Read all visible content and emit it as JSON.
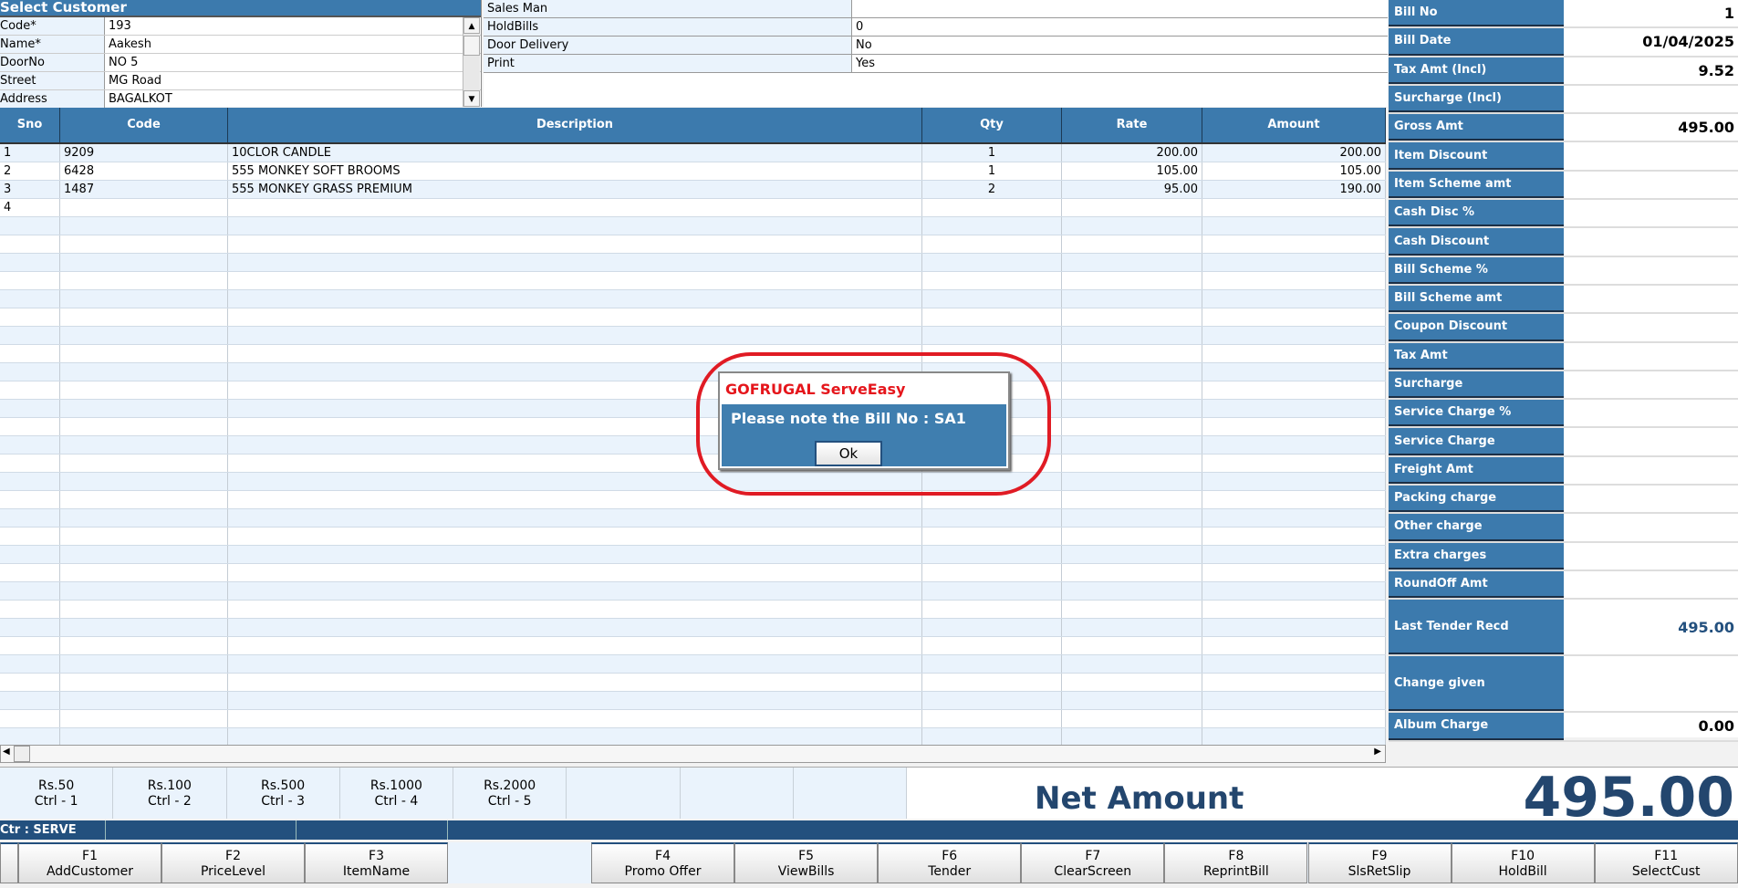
{
  "customer": {
    "title": "Select Customer",
    "fields": [
      {
        "label": "Code*",
        "value": "193"
      },
      {
        "label": "Name*",
        "value": "Aakesh"
      },
      {
        "label": "DoorNo",
        "value": "NO 5"
      },
      {
        "label": "Street",
        "value": "MG Road"
      },
      {
        "label": "Address",
        "value": "BAGALKOT"
      }
    ]
  },
  "info": [
    {
      "label": "Sales Man",
      "value": ""
    },
    {
      "label": "HoldBills",
      "value": "0"
    },
    {
      "label": "Door Delivery",
      "value": "No"
    },
    {
      "label": "Print",
      "value": "Yes"
    }
  ],
  "grid": {
    "headers": [
      "Sno",
      "Code",
      "Description",
      "Qty",
      "Rate",
      "Amount"
    ],
    "rows": [
      [
        "1",
        "9209",
        "10CLOR CANDLE",
        "1",
        "200.00",
        "200.00"
      ],
      [
        "2",
        "6428",
        "555 MONKEY SOFT BROOMS",
        "1",
        "105.00",
        "105.00"
      ],
      [
        "3",
        "1487",
        "555 MONKEY GRASS PREMIUM",
        "2",
        "95.00",
        "190.00"
      ],
      [
        "4",
        "",
        "",
        "",
        "",
        ""
      ]
    ]
  },
  "summary": [
    {
      "label": "Bill No",
      "value": "1"
    },
    {
      "label": "Bill Date",
      "value": "01/04/2025"
    },
    {
      "label": "Tax Amt (Incl)",
      "value": "9.52"
    },
    {
      "label": "Surcharge (Incl)",
      "value": ""
    },
    {
      "label": "Gross Amt",
      "value": "495.00"
    },
    {
      "label": "Item Discount",
      "value": ""
    },
    {
      "label": "Item Scheme amt",
      "value": ""
    },
    {
      "label": "Cash Disc %",
      "value": ""
    },
    {
      "label": "Cash Discount",
      "value": ""
    },
    {
      "label": "Bill Scheme %",
      "value": ""
    },
    {
      "label": "Bill Scheme amt",
      "value": ""
    },
    {
      "label": "Coupon Discount",
      "value": ""
    },
    {
      "label": "Tax Amt",
      "value": ""
    },
    {
      "label": "Surcharge",
      "value": ""
    },
    {
      "label": "Service Charge %",
      "value": ""
    },
    {
      "label": "Service Charge",
      "value": ""
    },
    {
      "label": "Freight Amt",
      "value": ""
    },
    {
      "label": "Packing charge",
      "value": ""
    },
    {
      "label": "Other charge",
      "value": ""
    },
    {
      "label": "Extra charges",
      "value": ""
    },
    {
      "label": "RoundOff Amt",
      "value": ""
    },
    {
      "label": "Last Tender Recd",
      "value": "495.00",
      "tall": true
    },
    {
      "label": "Change given",
      "value": "",
      "tall": true
    },
    {
      "label": "Album Charge",
      "value": "0.00"
    }
  ],
  "denominations": [
    {
      "amt": "Rs.50",
      "key": "Ctrl - 1"
    },
    {
      "amt": "Rs.100",
      "key": "Ctrl - 2"
    },
    {
      "amt": "Rs.500",
      "key": "Ctrl - 3"
    },
    {
      "amt": "Rs.1000",
      "key": "Ctrl - 4"
    },
    {
      "amt": "Rs.2000",
      "key": "Ctrl - 5"
    },
    {
      "amt": "",
      "key": ""
    },
    {
      "amt": "",
      "key": ""
    },
    {
      "amt": "",
      "key": ""
    }
  ],
  "net": {
    "label": "Net Amount",
    "value": "495.00"
  },
  "status": {
    "counter": "Ctr : SERVE"
  },
  "fkeys": [
    {
      "k": "F1",
      "l": "AddCustomer"
    },
    {
      "k": "F2",
      "l": "PriceLevel"
    },
    {
      "k": "F3",
      "l": "ItemName"
    },
    {
      "k": "F4",
      "l": "Promo Offer"
    },
    {
      "k": "F5",
      "l": "ViewBills"
    },
    {
      "k": "F6",
      "l": "Tender"
    },
    {
      "k": "F7",
      "l": "ClearScreen"
    },
    {
      "k": "F8",
      "l": "ReprintBill"
    },
    {
      "k": "F9",
      "l": "SlsRetSlip"
    },
    {
      "k": "F10",
      "l": "HoldBill"
    },
    {
      "k": "F11",
      "l": "SelectCust"
    }
  ],
  "dialog": {
    "title": "GOFRUGAL ServeEasy",
    "message": "Please note the Bill No : SA1",
    "ok": "Ok"
  },
  "colors": {
    "header": "#3c7aad",
    "net": "#23466e",
    "highlight": "#e01b24"
  }
}
